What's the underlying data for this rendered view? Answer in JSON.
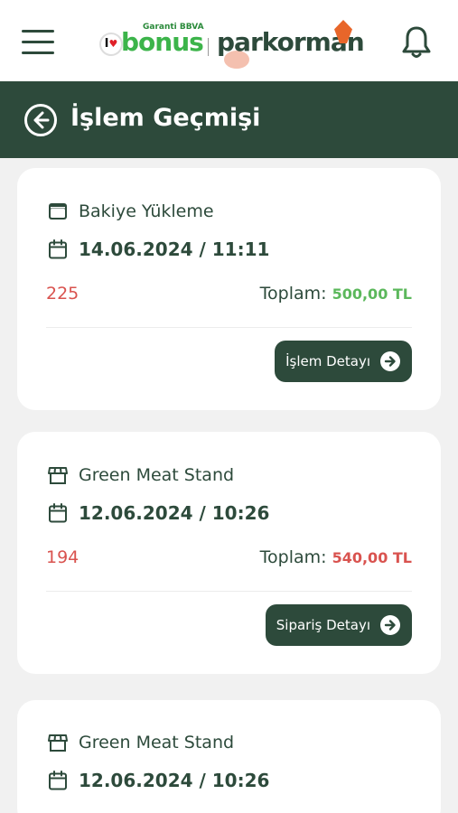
{
  "brand": {
    "bank": "Garanti BBVA",
    "bonus_i": "I",
    "bonus_heart": "♥",
    "bonus": "bonus",
    "partner": "parkorman"
  },
  "header": {
    "title": "İşlem Geçmişi"
  },
  "transactions": [
    {
      "name": "Bakiye Yükleme",
      "type_icon": "wallet-icon",
      "datetime": "14.06.2024 / 11:11",
      "code": "225",
      "total_label": "Toplam:",
      "total_value": "500,00 TL",
      "total_color": "#5cb85c",
      "button": "İşlem Detayı"
    },
    {
      "name": "Green Meat Stand",
      "type_icon": "store-icon",
      "datetime": "12.06.2024 / 10:26",
      "code": "194",
      "total_label": "Toplam:",
      "total_value": "540,00 TL",
      "total_color": "#d9534f",
      "button": "Sipariş Detayı"
    },
    {
      "name": "Green Meat Stand",
      "type_icon": "store-icon",
      "datetime": "12.06.2024 / 10:26"
    }
  ],
  "colors": {
    "primary": "#2d4a3b",
    "positive": "#5cb85c",
    "negative": "#d9534f",
    "background": "#f1f1f1"
  }
}
